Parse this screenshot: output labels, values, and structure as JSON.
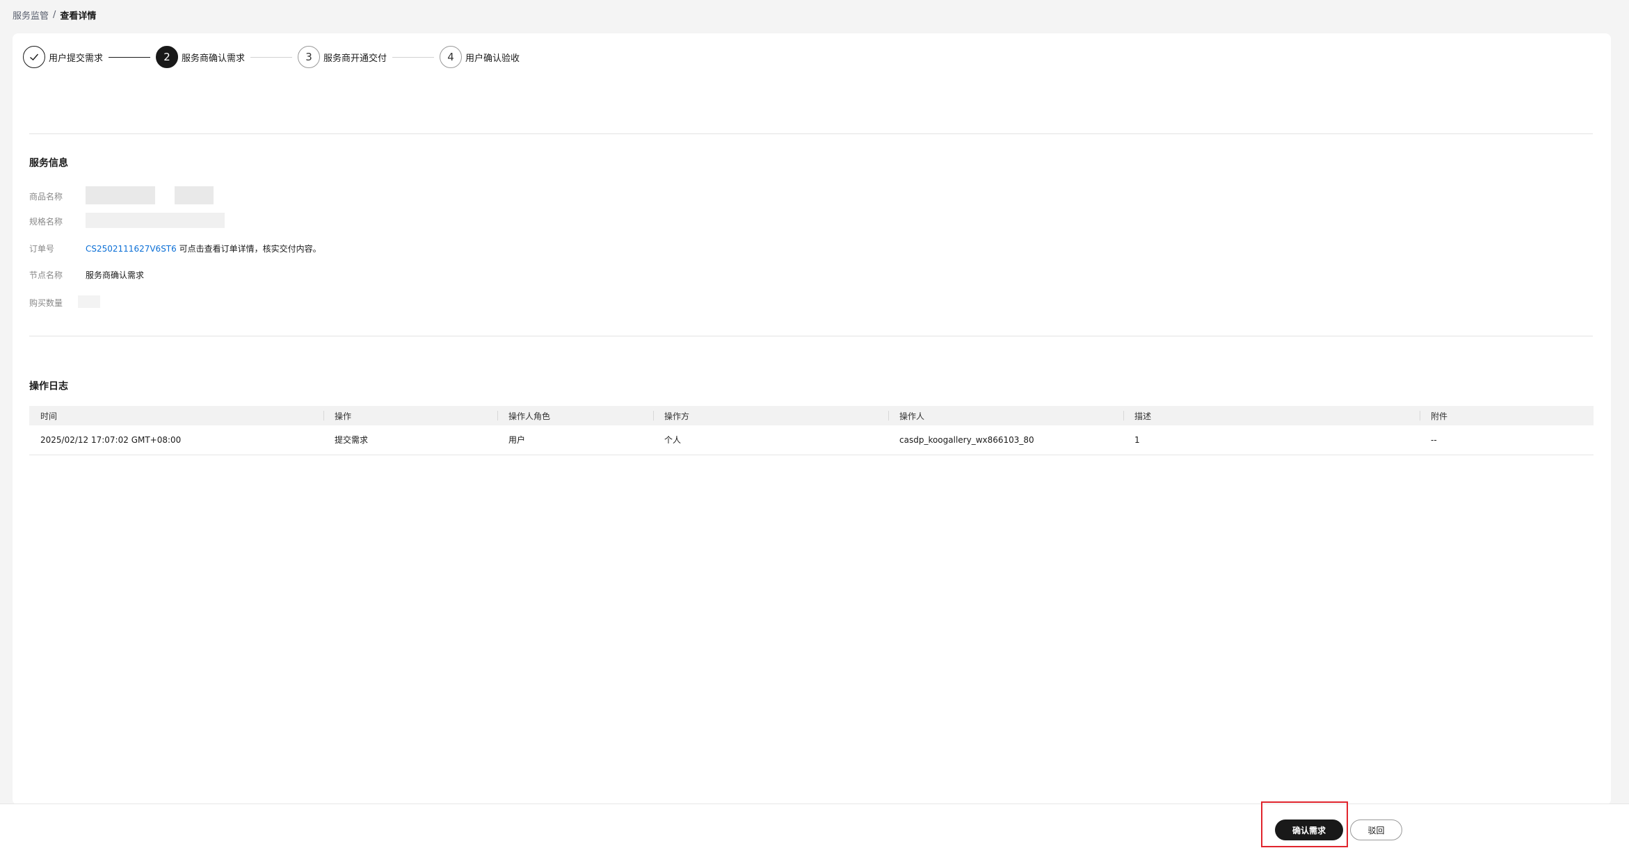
{
  "breadcrumb": {
    "parent": "服务监管",
    "separator": "/",
    "current": "查看详情"
  },
  "steps": [
    {
      "number": "",
      "label": "用户提交需求",
      "status": "done"
    },
    {
      "number": "2",
      "label": "服务商确认需求",
      "status": "active"
    },
    {
      "number": "3",
      "label": "服务商开通交付",
      "status": "pending"
    },
    {
      "number": "4",
      "label": "用户确认验收",
      "status": "pending"
    }
  ],
  "service_info": {
    "title": "服务信息",
    "product_name_label": "商品名称",
    "spec_name_label": "规格名称",
    "order_label": "订单号",
    "order_id": "CS2502111627V6ST6",
    "order_hint": "可点击查看订单详情，核实交付内容。",
    "node_label": "节点名称",
    "node_value": "服务商确认需求",
    "quantity_label": "购买数量"
  },
  "log": {
    "title": "操作日志",
    "columns": [
      "时间",
      "操作",
      "操作人角色",
      "操作方",
      "操作人",
      "描述",
      "附件"
    ],
    "rows": [
      [
        "2025/02/12 17:07:02 GMT+08:00",
        "提交需求",
        "用户",
        "个人",
        "casdp_koogallery_wx866103_80",
        "1",
        "--"
      ]
    ]
  },
  "footer": {
    "confirm_label": "确认需求",
    "reject_label": "驳回"
  }
}
